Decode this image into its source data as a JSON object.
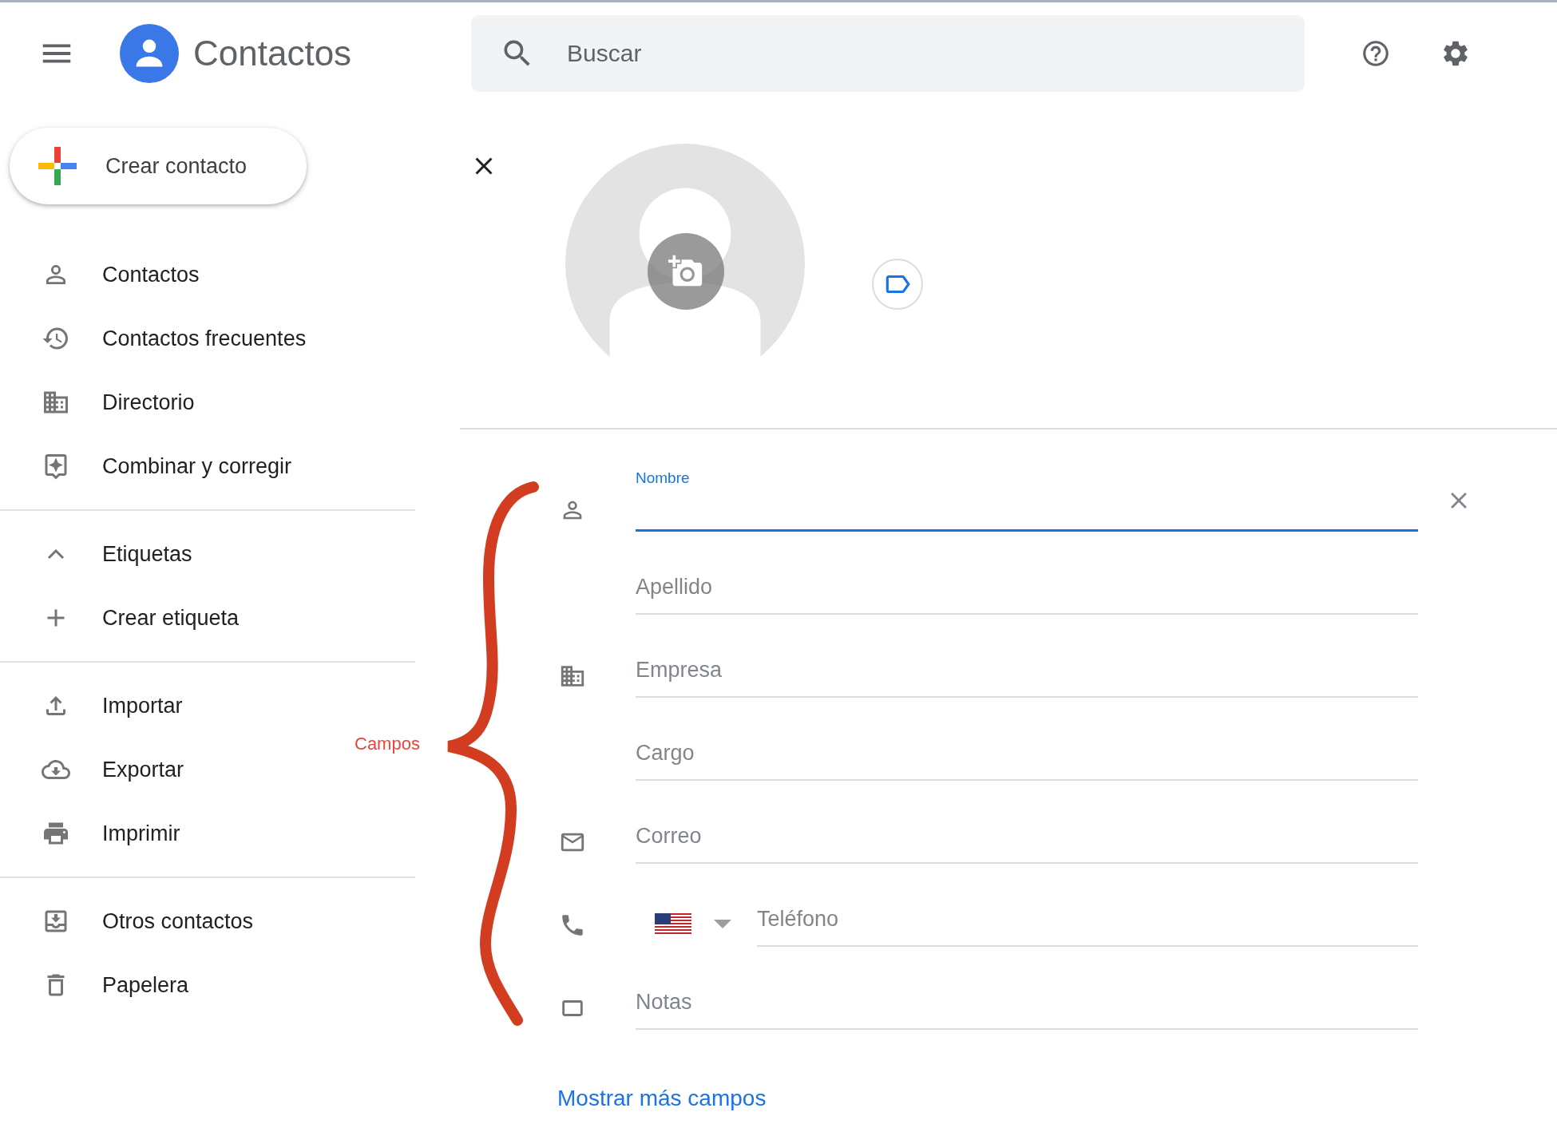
{
  "app": {
    "title": "Contactos"
  },
  "search": {
    "placeholder": "Buscar"
  },
  "create_button": {
    "label": "Crear contacto"
  },
  "sidebar": {
    "sections": [
      {
        "items": [
          {
            "label": "Contactos"
          },
          {
            "label": "Contactos frecuentes"
          },
          {
            "label": "Directorio"
          },
          {
            "label": "Combinar y corregir"
          }
        ]
      },
      {
        "items": [
          {
            "label": "Etiquetas",
            "kind": "toggle",
            "expanded": true
          },
          {
            "label": "Crear etiqueta",
            "kind": "link"
          }
        ]
      },
      {
        "items": [
          {
            "label": "Importar"
          },
          {
            "label": "Exportar"
          },
          {
            "label": "Imprimir"
          }
        ]
      },
      {
        "items": [
          {
            "label": "Otros contactos"
          },
          {
            "label": "Papelera"
          }
        ]
      }
    ]
  },
  "form": {
    "fields": [
      {
        "kind": "text",
        "placeholder": "Nombre",
        "focused": true
      },
      {
        "kind": "text",
        "placeholder": "Apellido",
        "focused": false
      },
      {
        "kind": "text",
        "placeholder": "Empresa",
        "focused": false
      },
      {
        "kind": "text",
        "placeholder": "Cargo",
        "focused": false
      },
      {
        "kind": "text",
        "placeholder": "Correo",
        "focused": false
      },
      {
        "kind": "phone",
        "placeholder": "Teléfono",
        "focused": false
      },
      {
        "kind": "text",
        "placeholder": "Notas",
        "focused": false
      }
    ],
    "more_link": "Mostrar más campos"
  },
  "annotation": {
    "text": "Campos"
  }
}
